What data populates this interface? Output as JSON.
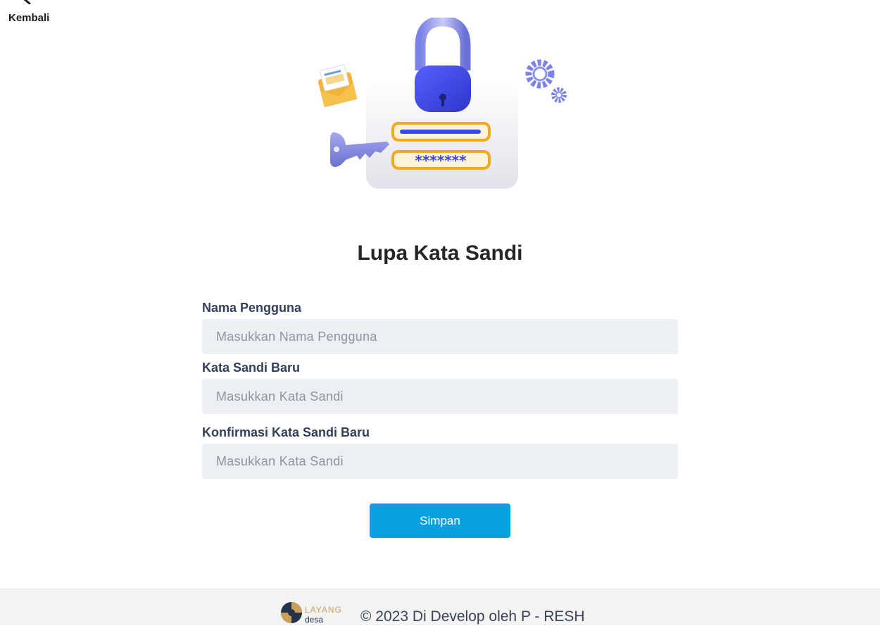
{
  "nav": {
    "back_label": "Kembali"
  },
  "page": {
    "title": "Lupa Kata Sandi"
  },
  "form": {
    "username": {
      "label": "Nama Pengguna",
      "placeholder": "Masukkan Nama Pengguna"
    },
    "new_password": {
      "label": "Kata Sandi Baru",
      "placeholder": "Masukkan Kata Sandi"
    },
    "confirm_password": {
      "label": "Konfirmasi Kata Sandi Baru",
      "placeholder": "Masukkan Kata Sandi"
    },
    "submit_label": "Simpan"
  },
  "hero": {
    "password_mask": "*******"
  },
  "footer": {
    "logo_text_top": "LAYANG",
    "logo_text_bottom": "desa",
    "copyright": "© 2023 Di Develop oleh P - RESH"
  },
  "colors": {
    "primary_button": "#0aa0e0",
    "input_background": "#eceff3",
    "label_text": "#33405a",
    "footer_background": "#f3f3f3",
    "lock_blue": "#3d4ae0",
    "accent_orange": "#f5a623"
  }
}
